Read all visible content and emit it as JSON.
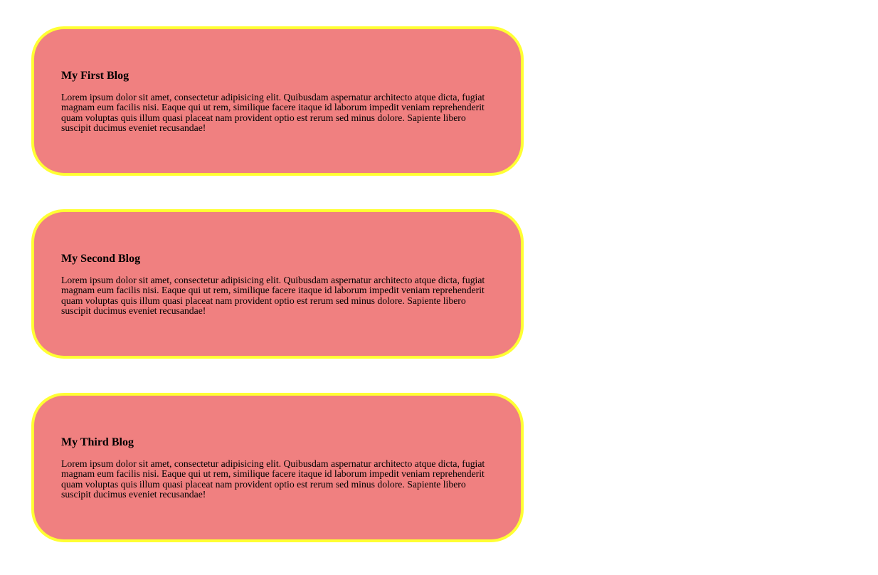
{
  "blogs": [
    {
      "title": "My First Blog",
      "body": "Lorem ipsum dolor sit amet, consectetur adipisicing elit. Quibusdam aspernatur architecto atque dicta, fugiat magnam eum facilis nisi. Eaque qui ut rem, similique facere itaque id laborum impedit veniam reprehenderit quam voluptas quis illum quasi placeat nam provident optio est rerum sed minus dolore. Sapiente libero suscipit ducimus eveniet recusandae!"
    },
    {
      "title": "My Second Blog",
      "body": "Lorem ipsum dolor sit amet, consectetur adipisicing elit. Quibusdam aspernatur architecto atque dicta, fugiat magnam eum facilis nisi. Eaque qui ut rem, similique facere itaque id laborum impedit veniam reprehenderit quam voluptas quis illum quasi placeat nam provident optio est rerum sed minus dolore. Sapiente libero suscipit ducimus eveniet recusandae!"
    },
    {
      "title": "My Third Blog",
      "body": "Lorem ipsum dolor sit amet, consectetur adipisicing elit. Quibusdam aspernatur architecto atque dicta, fugiat magnam eum facilis nisi. Eaque qui ut rem, similique facere itaque id laborum impedit veniam reprehenderit quam voluptas quis illum quasi placeat nam provident optio est rerum sed minus dolore. Sapiente libero suscipit ducimus eveniet recusandae!"
    }
  ],
  "colors": {
    "card_background": "#f08080",
    "card_border": "#ffff33",
    "text": "#000000",
    "page_background": "#ffffff"
  }
}
